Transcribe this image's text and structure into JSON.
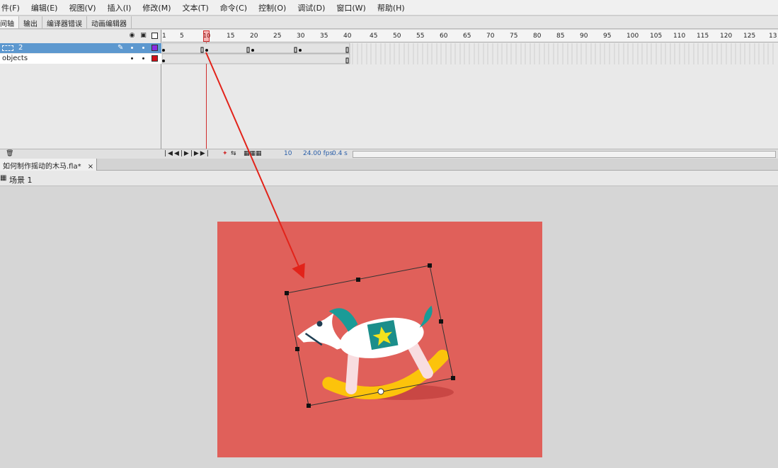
{
  "menu": [
    "件(F)",
    "编辑(E)",
    "视图(V)",
    "插入(I)",
    "修改(M)",
    "文本(T)",
    "命令(C)",
    "控制(O)",
    "调试(D)",
    "窗口(W)",
    "帮助(H)"
  ],
  "panel_tabs": [
    "间轴",
    "输出",
    "编译器错误",
    "动画编辑器"
  ],
  "layers": [
    {
      "name": "2",
      "color": "#8a2be2"
    },
    {
      "name": "objects",
      "color": "#d0101a"
    }
  ],
  "frame_numbers": [
    "1",
    "5",
    "10",
    "15",
    "20",
    "25",
    "30",
    "35",
    "40",
    "45",
    "50",
    "55",
    "60",
    "65",
    "70",
    "75",
    "80",
    "85",
    "90",
    "95",
    "100",
    "105",
    "110",
    "115",
    "120",
    "125",
    "13"
  ],
  "status": {
    "current_frame": "10",
    "fps": "24.00 fps",
    "time": "0.4 s"
  },
  "document": {
    "tab": "如何制作摇动的木马.fla*",
    "scene": "场景 1"
  },
  "colors": {
    "stage": "#e0605a",
    "horse_body": "#ffffff",
    "mane": "#1a9b97",
    "saddle": "#1b8e8b",
    "star": "#f4e21d",
    "rocker": "#fcc30b",
    "rocker_leg": "#f8dde0",
    "arrow": "#e2231a"
  }
}
